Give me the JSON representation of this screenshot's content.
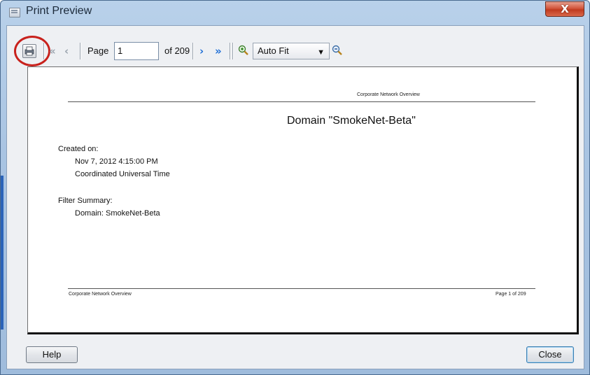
{
  "window": {
    "title": "Print Preview",
    "close_glyph": "X"
  },
  "toolbar": {
    "print_icon": "print-icon",
    "first_icon": "double-chevron-left-icon",
    "prev_icon": "chevron-left-icon",
    "next_icon": "chevron-right-icon",
    "last_icon": "double-chevron-right-icon",
    "zoom_in_icon": "zoom-in-icon",
    "zoom_out_icon": "zoom-out-icon",
    "page_label": "Page",
    "page_value": "1",
    "of_label": "of 209",
    "zoom_value": "Auto Fit",
    "nav_color_disabled": "#9aa3ad",
    "nav_color_active": "#1f6fd6",
    "highlight_color": "#c8211c"
  },
  "preview": {
    "header_text": "Corporate Network Overview",
    "title": "Domain \"SmokeNet-Beta\"",
    "created_label": "Created on:",
    "created_date": "Nov 7, 2012 4:15:00 PM",
    "created_tz": "Coordinated Universal Time",
    "filter_label": "Filter Summary:",
    "filter_value": "Domain: SmokeNet-Beta",
    "footer_left": "Corporate Network Overview",
    "footer_right": "Page 1 of  209"
  },
  "buttons": {
    "help": "Help",
    "close": "Close"
  }
}
